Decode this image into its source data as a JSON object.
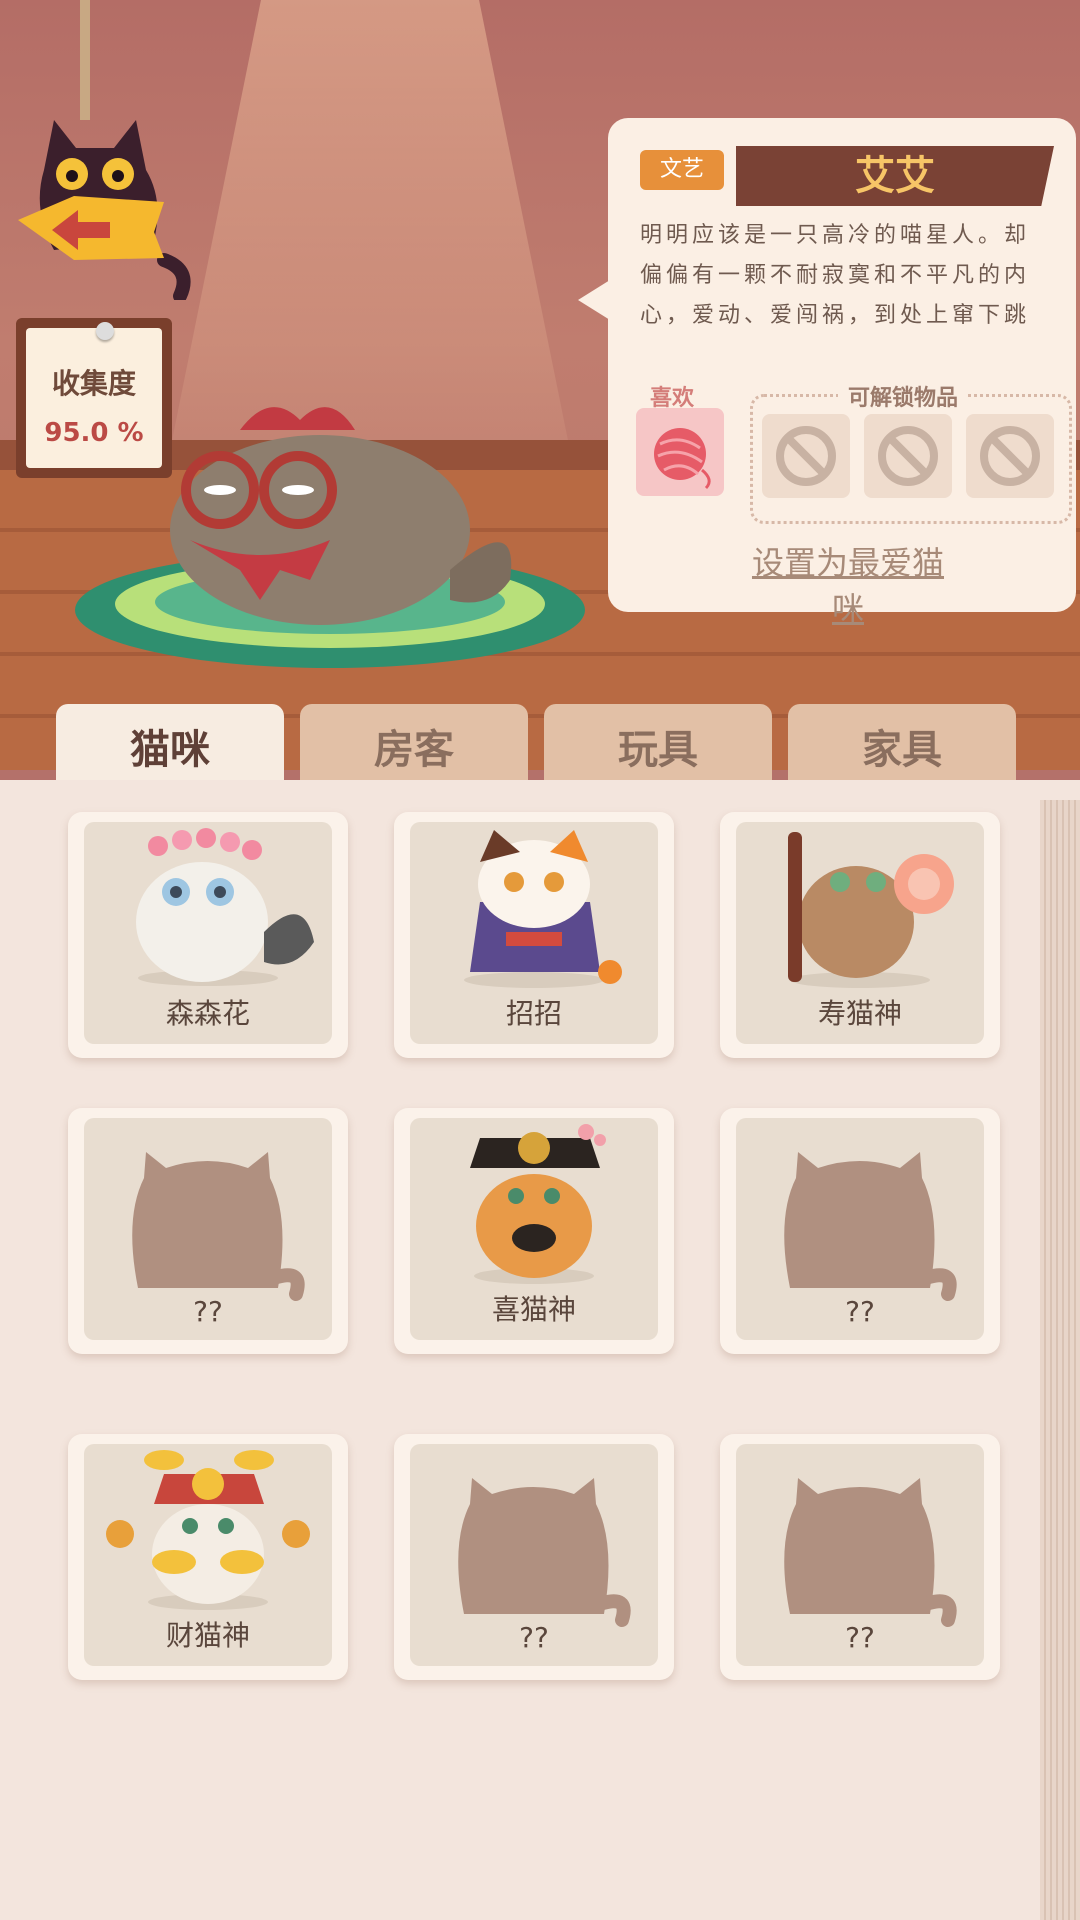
{
  "collection": {
    "label": "收集度",
    "value": "95.0 %"
  },
  "cat_profile": {
    "tag": "文艺",
    "name": "艾艾",
    "description": "明明应该是一只高冷的喵星人。却偏偏有一颗不耐寂寞和不平凡的内心，爱动、爱闯祸，到处上窜下跳",
    "likes_label": "喜欢",
    "liked_item_icon": "yarn-ball-icon",
    "unlock_label": "可解锁物品",
    "unlock_slots": [
      "locked",
      "locked",
      "locked"
    ],
    "set_favorite_label": "设置为最爱猫咪"
  },
  "tabs": [
    {
      "label": "猫咪",
      "active": true
    },
    {
      "label": "房客",
      "active": false
    },
    {
      "label": "玩具",
      "active": false
    },
    {
      "label": "家具",
      "active": false
    }
  ],
  "cats": [
    {
      "name": "森森花",
      "unlocked": true
    },
    {
      "name": "招招",
      "unlocked": true
    },
    {
      "name": "寿猫神",
      "unlocked": true
    },
    {
      "name": "??",
      "unlocked": false
    },
    {
      "name": "喜猫神",
      "unlocked": true
    },
    {
      "name": "??",
      "unlocked": false
    },
    {
      "name": "财猫神",
      "unlocked": true
    },
    {
      "name": "??",
      "unlocked": false
    },
    {
      "name": "??",
      "unlocked": false
    }
  ],
  "colors": {
    "accent": "#e7903a",
    "banner": "#7a4235",
    "name": "#f7c567"
  }
}
